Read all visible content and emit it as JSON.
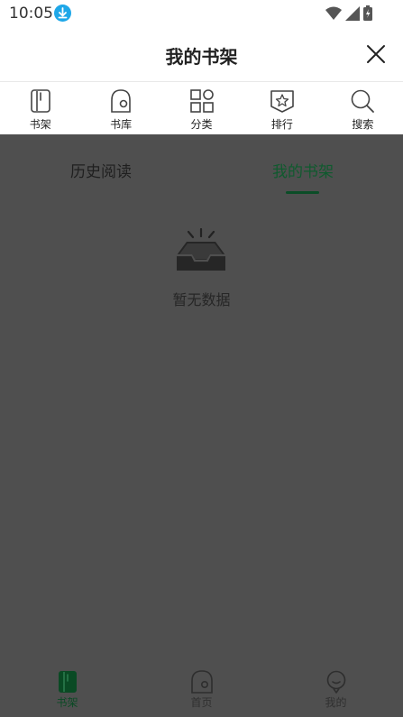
{
  "status_bar": {
    "time": "10:05"
  },
  "header": {
    "title": "我的书架"
  },
  "top_nav": [
    {
      "label": "书架",
      "icon": "book-icon"
    },
    {
      "label": "书库",
      "icon": "library-icon"
    },
    {
      "label": "分类",
      "icon": "category-grid-icon"
    },
    {
      "label": "排行",
      "icon": "ranking-star-icon"
    },
    {
      "label": "搜索",
      "icon": "search-icon"
    }
  ],
  "tabs": {
    "history": "历史阅读",
    "shelf": "我的书架",
    "active": "shelf"
  },
  "empty_state": {
    "text": "暂无数据",
    "icon": "empty-tray-icon"
  },
  "bottom_nav": [
    {
      "label": "书架",
      "icon": "book-icon",
      "active": true
    },
    {
      "label": "首页",
      "icon": "home-icon",
      "active": false
    },
    {
      "label": "我的",
      "icon": "profile-icon",
      "active": false
    }
  ],
  "colors": {
    "accent": "#0b4d27",
    "overlay": "#4f4f4f",
    "download_badge": "#1ea7e8"
  }
}
